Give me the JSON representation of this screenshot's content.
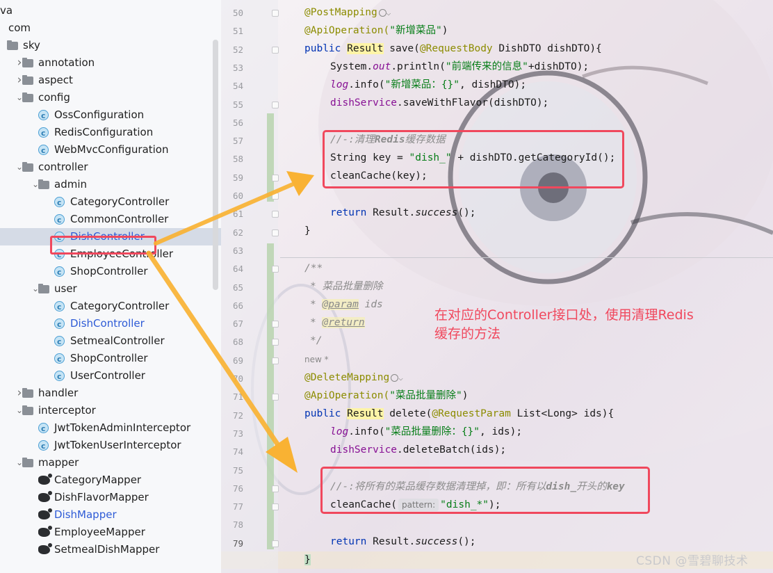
{
  "tree": {
    "items": [
      {
        "label": "va",
        "type": "text",
        "indent": 0,
        "chevron": ""
      },
      {
        "label": "com",
        "type": "text",
        "indent": 0,
        "chevron": ""
      },
      {
        "label": "sky",
        "type": "folder",
        "indent": 1,
        "chevron": ""
      },
      {
        "label": "annotation",
        "type": "folder",
        "indent": 2,
        "chevron": "right"
      },
      {
        "label": "aspect",
        "type": "folder",
        "indent": 2,
        "chevron": "right"
      },
      {
        "label": "config",
        "type": "folder",
        "indent": 2,
        "chevron": "down"
      },
      {
        "label": "OssConfiguration",
        "type": "class",
        "indent": 3,
        "chevron": ""
      },
      {
        "label": "RedisConfiguration",
        "type": "class",
        "indent": 3,
        "chevron": ""
      },
      {
        "label": "WebMvcConfiguration",
        "type": "class",
        "indent": 3,
        "chevron": ""
      },
      {
        "label": "controller",
        "type": "folder",
        "indent": 2,
        "chevron": "down"
      },
      {
        "label": "admin",
        "type": "folder",
        "indent": 3,
        "chevron": "down"
      },
      {
        "label": "CategoryController",
        "type": "class",
        "indent": 4,
        "chevron": ""
      },
      {
        "label": "CommonController",
        "type": "class",
        "indent": 4,
        "chevron": ""
      },
      {
        "label": "DishController",
        "type": "class",
        "indent": 4,
        "chevron": "",
        "selected": true,
        "blue": true
      },
      {
        "label": "EmployeeController",
        "type": "class",
        "indent": 4,
        "chevron": ""
      },
      {
        "label": "ShopController",
        "type": "class",
        "indent": 4,
        "chevron": ""
      },
      {
        "label": "user",
        "type": "folder",
        "indent": 3,
        "chevron": "down"
      },
      {
        "label": "CategoryController",
        "type": "class",
        "indent": 4,
        "chevron": ""
      },
      {
        "label": "DishController",
        "type": "class",
        "indent": 4,
        "chevron": "",
        "blue": true
      },
      {
        "label": "SetmealController",
        "type": "class",
        "indent": 4,
        "chevron": ""
      },
      {
        "label": "ShopController",
        "type": "class",
        "indent": 4,
        "chevron": ""
      },
      {
        "label": "UserController",
        "type": "class",
        "indent": 4,
        "chevron": ""
      },
      {
        "label": "handler",
        "type": "folder",
        "indent": 2,
        "chevron": "right"
      },
      {
        "label": "interceptor",
        "type": "folder",
        "indent": 2,
        "chevron": "down"
      },
      {
        "label": "JwtTokenAdminInterceptor",
        "type": "class",
        "indent": 3,
        "chevron": ""
      },
      {
        "label": "JwtTokenUserInterceptor",
        "type": "class",
        "indent": 3,
        "chevron": ""
      },
      {
        "label": "mapper",
        "type": "folder",
        "indent": 2,
        "chevron": "down"
      },
      {
        "label": "CategoryMapper",
        "type": "mapper",
        "indent": 3,
        "chevron": ""
      },
      {
        "label": "DishFlavorMapper",
        "type": "mapper",
        "indent": 3,
        "chevron": ""
      },
      {
        "label": "DishMapper",
        "type": "mapper",
        "indent": 3,
        "chevron": "",
        "blue": true
      },
      {
        "label": "EmployeeMapper",
        "type": "mapper",
        "indent": 3,
        "chevron": ""
      },
      {
        "label": "SetmealDishMapper",
        "type": "mapper",
        "indent": 3,
        "chevron": ""
      }
    ]
  },
  "editor": {
    "line_numbers": [
      "50",
      "51",
      "52",
      "53",
      "54",
      "55",
      "56",
      "57",
      "58",
      "59",
      "60",
      "61",
      "62",
      "63",
      "64",
      "65",
      "66",
      "67",
      "68",
      "69",
      "70",
      "71",
      "72",
      "73",
      "74",
      "75",
      "76",
      "77",
      "78",
      "79"
    ],
    "current_line": "79",
    "new_hint": "new *",
    "lines": {
      "l50_ann": "@PostMapping",
      "l51_ann": "@ApiOperation(",
      "l51_str": "\"新增菜品\"",
      "l51_end": ")",
      "l52_kw": "public ",
      "l52_type": "Result",
      "l52_rest1": " save(",
      "l52_ann": "@RequestBody",
      "l52_rest2": " DishDTO dishDTO){",
      "l53_a": "System.",
      "l53_out": "out",
      "l53_b": ".println(",
      "l53_str": "\"前端传来的信息\"",
      "l53_c": "+dishDTO);",
      "l54_log": "log",
      "l54_a": ".info(",
      "l54_str": "\"新增菜品：{}\"",
      "l54_b": ", dishDTO);",
      "l55_svc": "dishService",
      "l55_a": ".saveWithFlavor(dishDTO);",
      "l57_c1": "//-:清理",
      "l57_c2": "Redis",
      "l57_c3": "缓存数据",
      "l58_a": "String key = ",
      "l58_str": "\"dish_\"",
      "l58_b": " + dishDTO.getCategoryId();",
      "l59": "cleanCache(key);",
      "l61_kw": "return ",
      "l61_a": "Result.",
      "l61_succ": "success",
      "l61_b": "();",
      "l62": "}",
      "l64": "/**",
      "l65": "* 菜品批量删除",
      "l66_a": "* ",
      "l66_tag": "@param",
      "l66_b": " ids",
      "l67_a": "* ",
      "l67_tag": "@return",
      "l68": "*/",
      "l69_ann": "@DeleteMapping",
      "l70_ann": "@ApiOperation(",
      "l70_str": "\"菜品批量删除\"",
      "l70_end": ")",
      "l71_kw": "public ",
      "l71_type": "Result",
      "l71_rest1": " delete(",
      "l71_ann": "@RequestParam",
      "l71_rest2": " List<Long> ids){",
      "l72_log": "log",
      "l72_a": ".info(",
      "l72_str": "\"菜品批量删除：{}\"",
      "l72_b": ", ids);",
      "l73_svc": "dishService",
      "l73_a": ".deleteBatch(ids);",
      "l75_c1": "//-:将所有的菜品缓存数据清理掉，即：所有以",
      "l75_c2": "dish_",
      "l75_c3": "开头的",
      "l75_c4": "key",
      "l76_a": "cleanCache(",
      "l76_hint": "pattern:",
      "l76_str": "\"dish_*\"",
      "l76_b": ");",
      "l78_kw": "return ",
      "l78_a": "Result.",
      "l78_succ": "success",
      "l78_b": "();",
      "l79": "}"
    }
  },
  "callout": {
    "line1": "在对应的Controller接口处，使用清理Redis",
    "line2": "缓存的方法"
  },
  "watermark": "CSDN @雪碧聊技术",
  "colors": {
    "highlight_red": "#f0485d",
    "arrow_orange": "#f9b233",
    "keyword_blue": "#0033b3",
    "string_green": "#067d17"
  }
}
